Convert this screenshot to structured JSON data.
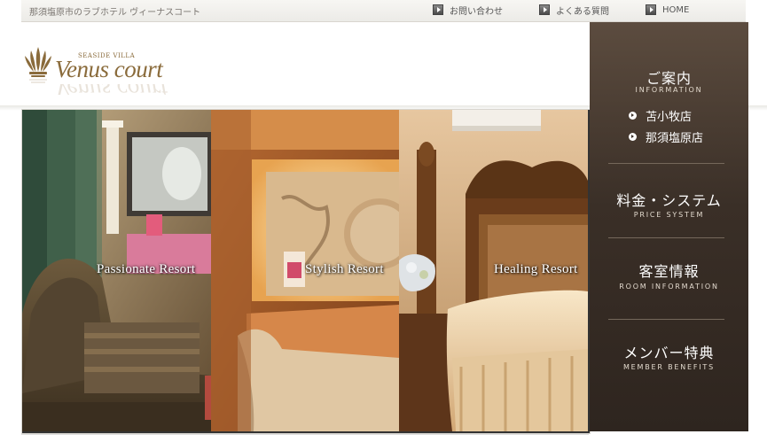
{
  "topbar": {
    "tagline": "那須塩原市のラブホテル ヴィーナスコート",
    "links": [
      {
        "label": "お問い合わせ"
      },
      {
        "label": "よくある質問"
      },
      {
        "label": "HOME"
      }
    ]
  },
  "logo": {
    "small": "SEASIDE VILLA",
    "main": "Venus court"
  },
  "hero": {
    "panels": [
      {
        "label": "Passionate Resort"
      },
      {
        "label": "Stylish Resort"
      },
      {
        "label": "Healing Resort"
      }
    ]
  },
  "sidebar": {
    "information": {
      "title": "ご案内",
      "sub": "INFORMATION",
      "shops": [
        "苫小牧店",
        "那須塩原店"
      ]
    },
    "price": {
      "title": "料金・システム",
      "sub": "PRICE SYSTEM"
    },
    "room": {
      "title": "客室情報",
      "sub": "ROOM INFORMATION"
    },
    "member": {
      "title": "メンバー特典",
      "sub": "MEMBER BENEFITS"
    }
  },
  "colors": {
    "brand": "#8a6b3b",
    "sidebar": "#3a2f27"
  }
}
